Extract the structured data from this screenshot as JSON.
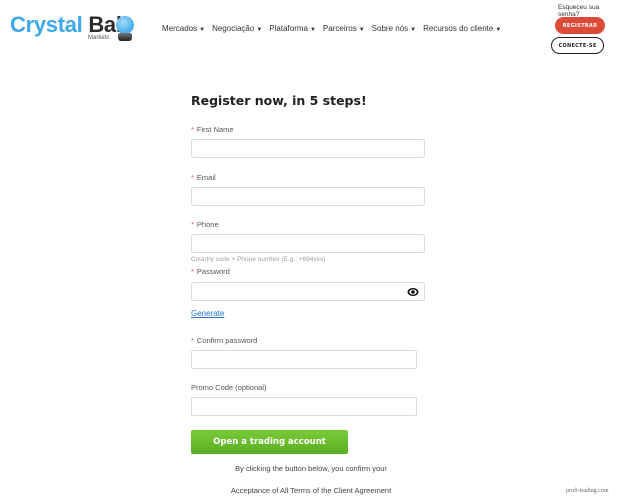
{
  "brand": {
    "name_part1": "Crystal",
    "name_part2": "Ball",
    "sub": "Markets",
    "accent_color": "#3ea8e8"
  },
  "nav": {
    "items": [
      {
        "label": "Mercados",
        "icon": "caret-down-icon"
      },
      {
        "label": "Negociação",
        "icon": "caret-down-icon"
      },
      {
        "label": "Plataforma",
        "icon": "caret-down-icon"
      },
      {
        "label": "Parceiros",
        "icon": "caret-down-icon"
      },
      {
        "label": "Sobre nós",
        "icon": "caret-down-icon"
      },
      {
        "label": "Recursos do cliente",
        "icon": "caret-down-icon"
      }
    ],
    "caret": "▼"
  },
  "account": {
    "forgot_password": "Esqueceu sua senha?",
    "register_label": "REGISTRAR",
    "register_color": "#dc4a38",
    "connect_label": "CONECTE-SE"
  },
  "form": {
    "title": "Register now, in 5 steps!",
    "required_marker": "*",
    "fields": {
      "first_name": {
        "label": "First Name",
        "value": "",
        "placeholder": ""
      },
      "email": {
        "label": "Email",
        "value": "",
        "placeholder": ""
      },
      "phone": {
        "label": "Phone",
        "value": "",
        "placeholder": "",
        "hint": "Country code + Phone number (E.g.: +694xxx)"
      },
      "password": {
        "label": "Password",
        "value": "",
        "placeholder": "",
        "icon": "eye-icon"
      },
      "confirm_password": {
        "label": "Confirm password",
        "value": "",
        "placeholder": ""
      },
      "promo_code": {
        "label": "Promo Code (optional)",
        "value": "",
        "placeholder": ""
      }
    },
    "generate_link": "Generate",
    "submit_label": "Open a trading account",
    "submit_color": "#6abf2e",
    "terms_line1": "By clicking the button below, you confirm your",
    "terms_line2": "Acceptance of All Terms of the Client Agreement"
  },
  "watermark": "profi-trading.com"
}
